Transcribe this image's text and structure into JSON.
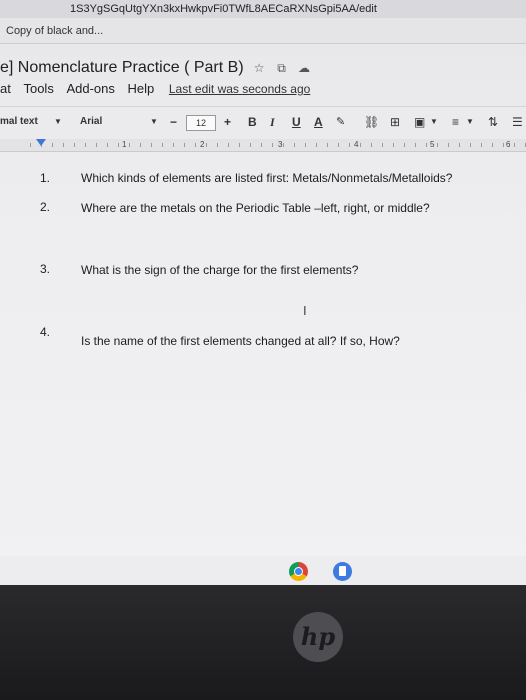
{
  "browser": {
    "url_fragment": "1S3YgSGqUtgYXn3kxHwkpvFi0TWfL8AECaRXNsGpi5AA/edit",
    "bookmark": "Copy of black and..."
  },
  "doc": {
    "title": "e] Nomenclature Practice ( Part B)",
    "icons": [
      "star-icon",
      "move-to-folder-icon",
      "cloud-saved-icon"
    ]
  },
  "menu": {
    "items": [
      "at",
      "Tools",
      "Add-ons",
      "Help"
    ],
    "last_edit": "Last edit was seconds ago"
  },
  "toolbar": {
    "style": "mal text",
    "font": "Arial",
    "minus": "−",
    "font_size": "12",
    "plus": "+",
    "bold": "B",
    "italic": "I",
    "underline": "U",
    "text_color": "A",
    "link_icon": "link-icon",
    "comment_icon": "comment-icon",
    "image_icon": "image-icon",
    "align_icon": "align-icon",
    "line_spacing_icon": "line-spacing-icon",
    "list_icon": "list-icon"
  },
  "ruler": {
    "numbers": [
      "1",
      "2",
      "3",
      "4",
      "5",
      "6"
    ]
  },
  "questions": [
    {
      "num": "1.",
      "text": "Which kinds of elements are listed first: Metals/Nonmetals/Metalloids?"
    },
    {
      "num": "2.",
      "text": "Where are the metals on the Periodic Table –left, right, or middle?"
    },
    {
      "num": "3.",
      "text": "What is the sign of the charge for the first elements?"
    },
    {
      "num": "4.",
      "text": "Is the name of the first elements changed at all? If so, How?"
    }
  ],
  "cursor": "I",
  "shelf": {
    "apps": [
      "chrome-icon",
      "docs-icon"
    ]
  },
  "laptop": {
    "logo": "hp"
  }
}
